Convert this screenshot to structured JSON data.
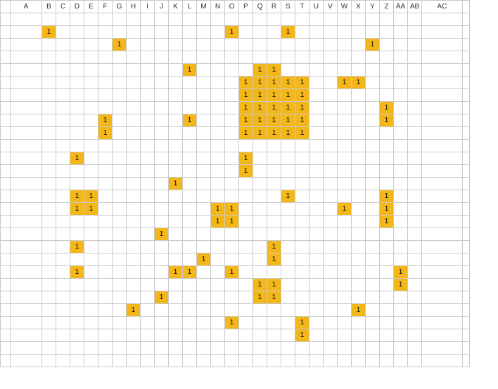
{
  "columns": [
    "A",
    "B",
    "C",
    "D",
    "E",
    "F",
    "G",
    "H",
    "I",
    "J",
    "K",
    "L",
    "M",
    "N",
    "O",
    "P",
    "Q",
    "R",
    "S",
    "T",
    "U",
    "V",
    "W",
    "X",
    "Y",
    "Z",
    "AA",
    "AB",
    "AC"
  ],
  "col_widths": {
    "A": 45,
    "AC": 58
  },
  "default_col_width": 20,
  "row_count": 28,
  "cell_value": "1",
  "chart_data": {
    "type": "table",
    "title": "",
    "filled_cells": [
      {
        "r": 2,
        "c": "B"
      },
      {
        "r": 2,
        "c": "O"
      },
      {
        "r": 2,
        "c": "S"
      },
      {
        "r": 3,
        "c": "G"
      },
      {
        "r": 3,
        "c": "Y"
      },
      {
        "r": 5,
        "c": "L"
      },
      {
        "r": 5,
        "c": "Q"
      },
      {
        "r": 5,
        "c": "R"
      },
      {
        "r": 6,
        "c": "P"
      },
      {
        "r": 6,
        "c": "Q"
      },
      {
        "r": 6,
        "c": "R"
      },
      {
        "r": 6,
        "c": "S"
      },
      {
        "r": 6,
        "c": "T"
      },
      {
        "r": 6,
        "c": "W"
      },
      {
        "r": 6,
        "c": "X"
      },
      {
        "r": 7,
        "c": "P"
      },
      {
        "r": 7,
        "c": "Q"
      },
      {
        "r": 7,
        "c": "R"
      },
      {
        "r": 7,
        "c": "S"
      },
      {
        "r": 7,
        "c": "T"
      },
      {
        "r": 8,
        "c": "P"
      },
      {
        "r": 8,
        "c": "Q"
      },
      {
        "r": 8,
        "c": "R"
      },
      {
        "r": 8,
        "c": "S"
      },
      {
        "r": 8,
        "c": "T"
      },
      {
        "r": 8,
        "c": "Z"
      },
      {
        "r": 9,
        "c": "F"
      },
      {
        "r": 9,
        "c": "L"
      },
      {
        "r": 9,
        "c": "P"
      },
      {
        "r": 9,
        "c": "Q"
      },
      {
        "r": 9,
        "c": "R"
      },
      {
        "r": 9,
        "c": "S"
      },
      {
        "r": 9,
        "c": "T"
      },
      {
        "r": 9,
        "c": "Z"
      },
      {
        "r": 10,
        "c": "F"
      },
      {
        "r": 10,
        "c": "P"
      },
      {
        "r": 10,
        "c": "Q"
      },
      {
        "r": 10,
        "c": "R"
      },
      {
        "r": 10,
        "c": "S"
      },
      {
        "r": 10,
        "c": "T"
      },
      {
        "r": 12,
        "c": "D"
      },
      {
        "r": 12,
        "c": "P"
      },
      {
        "r": 13,
        "c": "P"
      },
      {
        "r": 14,
        "c": "K"
      },
      {
        "r": 15,
        "c": "D"
      },
      {
        "r": 15,
        "c": "E"
      },
      {
        "r": 15,
        "c": "S"
      },
      {
        "r": 15,
        "c": "Z"
      },
      {
        "r": 16,
        "c": "D"
      },
      {
        "r": 16,
        "c": "E"
      },
      {
        "r": 16,
        "c": "N"
      },
      {
        "r": 16,
        "c": "O"
      },
      {
        "r": 16,
        "c": "W"
      },
      {
        "r": 16,
        "c": "Z"
      },
      {
        "r": 17,
        "c": "N"
      },
      {
        "r": 17,
        "c": "O"
      },
      {
        "r": 17,
        "c": "Z"
      },
      {
        "r": 18,
        "c": "J"
      },
      {
        "r": 19,
        "c": "D"
      },
      {
        "r": 19,
        "c": "R"
      },
      {
        "r": 20,
        "c": "M"
      },
      {
        "r": 20,
        "c": "R"
      },
      {
        "r": 21,
        "c": "D"
      },
      {
        "r": 21,
        "c": "K"
      },
      {
        "r": 21,
        "c": "L"
      },
      {
        "r": 21,
        "c": "O"
      },
      {
        "r": 21,
        "c": "AA"
      },
      {
        "r": 22,
        "c": "Q"
      },
      {
        "r": 22,
        "c": "R"
      },
      {
        "r": 22,
        "c": "AA"
      },
      {
        "r": 23,
        "c": "J"
      },
      {
        "r": 23,
        "c": "Q"
      },
      {
        "r": 23,
        "c": "R"
      },
      {
        "r": 24,
        "c": "H"
      },
      {
        "r": 24,
        "c": "X"
      },
      {
        "r": 25,
        "c": "O"
      },
      {
        "r": 25,
        "c": "T"
      },
      {
        "r": 26,
        "c": "T"
      }
    ]
  }
}
